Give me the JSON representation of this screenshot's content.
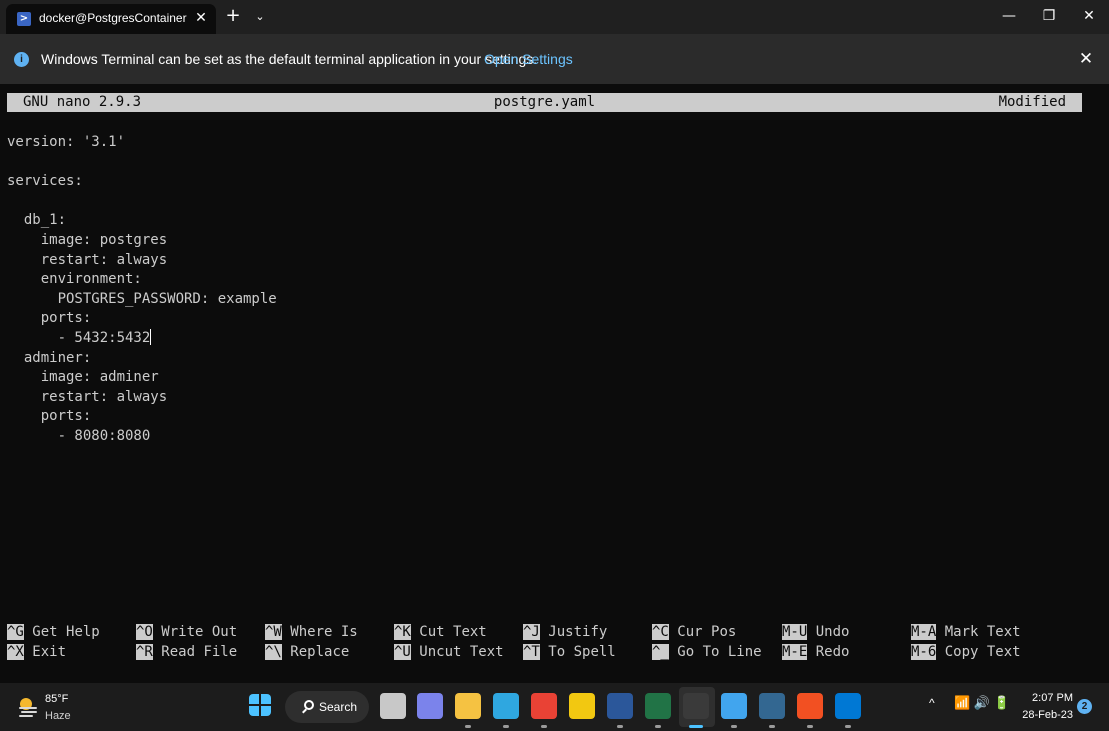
{
  "window": {
    "tab_title": "docker@PostgresContainer-Li",
    "tab_close_glyph": "✕",
    "new_tab_glyph": "+",
    "dropdown_glyph": "⌄",
    "minimize_glyph": "—",
    "maximize_glyph": "❐",
    "close_glyph": "✕"
  },
  "infobar": {
    "icon": "i",
    "message": "Windows Terminal can be set as the default terminal application in your settings.",
    "link": "Open Settings",
    "close_glyph": "✕"
  },
  "nano": {
    "version": "GNU nano 2.9.3",
    "filename": "postgre.yaml",
    "status": "Modified",
    "lines": [
      "version: '3.1'",
      "",
      "services:",
      "",
      "  db_1:",
      "    image: postgres",
      "    restart: always",
      "    environment:",
      "      POSTGRES_PASSWORD: example",
      "    ports:",
      "      - 5432:5432",
      "  adminer:",
      "    image: adminer",
      "    restart: always",
      "    ports:",
      "      - 8080:8080"
    ],
    "cursor_line": 10,
    "shortcuts_row1": [
      {
        "key": "^G",
        "label": "Get Help"
      },
      {
        "key": "^O",
        "label": "Write Out"
      },
      {
        "key": "^W",
        "label": "Where Is"
      },
      {
        "key": "^K",
        "label": "Cut Text"
      },
      {
        "key": "^J",
        "label": "Justify"
      },
      {
        "key": "^C",
        "label": "Cur Pos"
      },
      {
        "key": "M-U",
        "label": "Undo"
      },
      {
        "key": "M-A",
        "label": "Mark Text"
      }
    ],
    "shortcuts_row2": [
      {
        "key": "^X",
        "label": "Exit"
      },
      {
        "key": "^R",
        "label": "Read File"
      },
      {
        "key": "^\\",
        "label": "Replace"
      },
      {
        "key": "^U",
        "label": "Uncut Text"
      },
      {
        "key": "^T",
        "label": "To Spell"
      },
      {
        "key": "^_",
        "label": "Go To Line"
      },
      {
        "key": "M-E",
        "label": "Redo"
      },
      {
        "key": "M-6",
        "label": "Copy Text"
      }
    ]
  },
  "taskbar": {
    "weather_temp": "85°F",
    "weather_desc": "Haze",
    "search_label": "Search",
    "tray_chevron": "^",
    "tray_icons": "📶 🔊 🔋",
    "clock_time": "2:07 PM",
    "clock_date": "28-Feb-23",
    "notification_count": "2",
    "apps": [
      {
        "name": "task-view-icon",
        "color": "#c8c8c8"
      },
      {
        "name": "teams-chat-icon",
        "color": "#7b83eb"
      },
      {
        "name": "file-explorer-icon",
        "color": "#f5c242"
      },
      {
        "name": "edge-icon",
        "color": "#2fa7e0"
      },
      {
        "name": "chrome-icon",
        "color": "#e94235"
      },
      {
        "name": "power-bi-icon",
        "color": "#f2c811"
      },
      {
        "name": "word-icon",
        "color": "#2b579a"
      },
      {
        "name": "excel-icon",
        "color": "#217346"
      },
      {
        "name": "terminal-icon",
        "color": "#3a3a3a"
      },
      {
        "name": "notepad-icon",
        "color": "#41a5ee"
      },
      {
        "name": "pgadmin-icon",
        "color": "#336791"
      },
      {
        "name": "microsoft-store-icon",
        "color": "#f25022"
      },
      {
        "name": "vscode-icon",
        "color": "#0078d4"
      }
    ]
  }
}
